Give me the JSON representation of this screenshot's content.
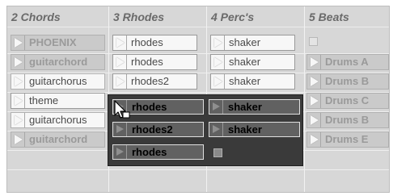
{
  "tracks": [
    {
      "name": "2 Chords"
    },
    {
      "name": "3 Rhodes"
    },
    {
      "name": "4 Perc's"
    },
    {
      "name": "5 Beats"
    }
  ],
  "chords_clips": [
    {
      "label": "PHOENIX",
      "style": "dim-bold"
    },
    {
      "label": "guitarchord",
      "style": "dim"
    },
    {
      "label": "guitarchorus",
      "style": "white"
    },
    {
      "label": "theme",
      "style": "white"
    },
    {
      "label": "guitarchorus",
      "style": "dim"
    },
    {
      "label": "guitarchord",
      "style": "dim"
    }
  ],
  "rhodes_clips": [
    {
      "label": "rhodes"
    },
    {
      "label": "rhodes"
    },
    {
      "label": "rhodes2"
    }
  ],
  "percs_clips": [
    {
      "label": "shaker"
    },
    {
      "label": "shaker"
    },
    {
      "label": "shaker"
    }
  ],
  "beats_clips": [
    {
      "label": ""
    },
    {
      "label": "Drums A"
    },
    {
      "label": "Drums B"
    },
    {
      "label": "Drums C"
    },
    {
      "label": "Drums B"
    },
    {
      "label": "Drums E"
    }
  ],
  "drag_preview": {
    "rhodes": [
      "rhodes",
      "rhodes2",
      "rhodes"
    ],
    "percs": [
      "shaker",
      "shaker",
      ""
    ]
  },
  "colors": {
    "session_bg": "#d7d7d7",
    "clip_white": "#f7f7f7",
    "clip_dim": "#cacaca",
    "drag_bg": "#3a3a3a",
    "drag_clip": "#616161"
  }
}
